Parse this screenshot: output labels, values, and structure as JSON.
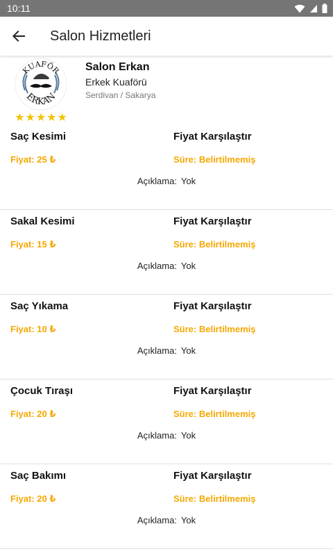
{
  "status_bar": {
    "time": "10:11"
  },
  "app_bar": {
    "title": "Salon Hizmetleri"
  },
  "salon": {
    "name": "Salon Erkan",
    "type": "Erkek Kuaförü",
    "location": "Serdivan / Sakarya",
    "logo_text_top": "KUAFÖR",
    "logo_text_bottom": "ERKAN",
    "rating": 5
  },
  "services": [
    {
      "name": "Saç Kesimi",
      "compare": "Fiyat Karşılaştır",
      "price": "Fiyat: 25 ₺",
      "duration": "Süre: Belirtilmemiş",
      "desc_label": "Açıklama:",
      "desc_value": "Yok"
    },
    {
      "name": "Sakal Kesimi",
      "compare": "Fiyat Karşılaştır",
      "price": "Fiyat: 15 ₺",
      "duration": "Süre: Belirtilmemiş",
      "desc_label": "Açıklama:",
      "desc_value": "Yok"
    },
    {
      "name": "Saç Yıkama",
      "compare": "Fiyat Karşılaştır",
      "price": "Fiyat: 10 ₺",
      "duration": "Süre: Belirtilmemiş",
      "desc_label": "Açıklama:",
      "desc_value": "Yok"
    },
    {
      "name": "Çocuk Tıraşı",
      "compare": "Fiyat Karşılaştır",
      "price": "Fiyat: 20 ₺",
      "duration": "Süre: Belirtilmemiş",
      "desc_label": "Açıklama:",
      "desc_value": "Yok"
    },
    {
      "name": "Saç Bakımı",
      "compare": "Fiyat Karşılaştır",
      "price": "Fiyat: 20 ₺",
      "duration": "Süre: Belirtilmemiş",
      "desc_label": "Açıklama:",
      "desc_value": "Yok"
    }
  ],
  "colors": {
    "accent": "#f5a800",
    "star": "#f2c200",
    "status_bar": "#757575"
  },
  "icons": {
    "back": "arrow-left-icon",
    "wifi": "wifi-icon",
    "signal": "signal-icon",
    "battery": "battery-icon"
  }
}
